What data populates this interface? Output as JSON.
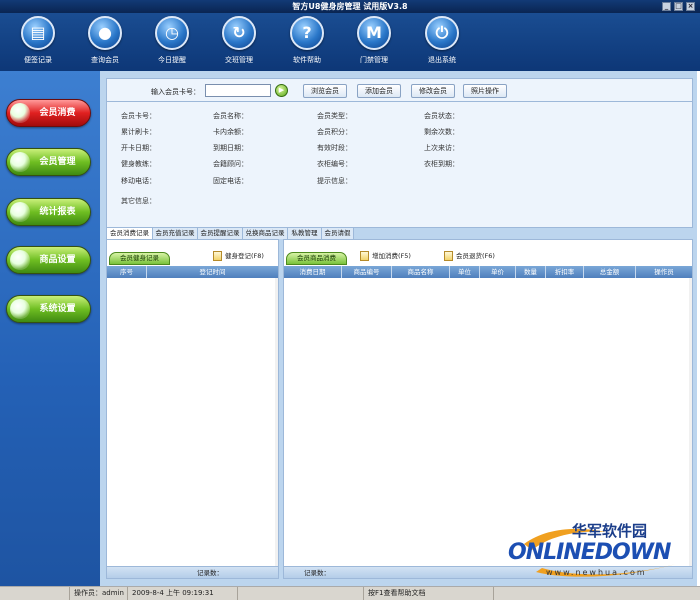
{
  "window": {
    "title": "智方U8健身房管理 试用版V3.8",
    "min": "_",
    "max": "□",
    "close": "×"
  },
  "toolbar": [
    {
      "label": "便签记录",
      "icon": "notepad-icon",
      "glyph": "▤"
    },
    {
      "label": "查询会员",
      "icon": "member-search-icon",
      "glyph": "●"
    },
    {
      "label": "今日提醒",
      "icon": "clock-icon",
      "glyph": "◷"
    },
    {
      "label": "交班管理",
      "icon": "refresh-icon",
      "glyph": "↻"
    },
    {
      "label": "软件帮助",
      "icon": "help-icon",
      "glyph": "?"
    },
    {
      "label": "门禁管理",
      "icon": "door-m-icon",
      "glyph": "M"
    },
    {
      "label": "退出系统",
      "icon": "power-icon",
      "glyph": "⏻"
    }
  ],
  "sidebar": [
    {
      "label": "会员消费",
      "active": true
    },
    {
      "label": "会员管理",
      "active": false
    },
    {
      "label": "统计报表",
      "active": false
    },
    {
      "label": "商品设置",
      "active": false
    },
    {
      "label": "系统设置",
      "active": false
    }
  ],
  "filter": {
    "card_label": "输入会员卡号：",
    "card_value": "",
    "go": "▶",
    "buttons": [
      "浏览会员",
      "添加会员",
      "修改会员",
      "照片操作"
    ]
  },
  "info": {
    "rows": [
      [
        "会员卡号：",
        "会员名称：",
        "会员类型：",
        "会员状态："
      ],
      [
        "累计刷卡：",
        "卡内余额：",
        "会员积分：",
        "剩余次数："
      ],
      [
        "开卡日期：",
        "到期日期：",
        "有效时段：",
        "上次来访："
      ],
      [
        "健身教练：",
        "会籍顾问：",
        "衣柜编号：",
        "衣柜到期："
      ],
      [
        "移动电话：",
        "固定电话：",
        "提示信息：",
        ""
      ]
    ],
    "other": "其它信息："
  },
  "tabs": [
    "会员消费记录",
    "会员充值记录",
    "会员提醒记录",
    "兑换商品记录",
    "私教管理",
    "会员请假"
  ],
  "left_panel": {
    "tab": "会员健身记录",
    "action": "健身登记(F8)",
    "columns": [
      "序号",
      "登记时间"
    ],
    "footer": "记录数："
  },
  "right_panel": {
    "tab": "会员商品消费",
    "actions": [
      "增加消费(F5)",
      "会员退货(F6)"
    ],
    "columns": [
      "消费日期",
      "商品编号",
      "商品名称",
      "单位",
      "单价",
      "数量",
      "折扣率",
      "总金额",
      "操作员"
    ],
    "footer": "记录数："
  },
  "status": {
    "operator": "操作员：admin",
    "datetime": "2009-8-4 上午 09:19:31",
    "help": "按F1查看帮助文档"
  },
  "watermark": {
    "cn": "华军软件园",
    "en": "ONLINEDOWN",
    "url": "www.newhua.com"
  }
}
